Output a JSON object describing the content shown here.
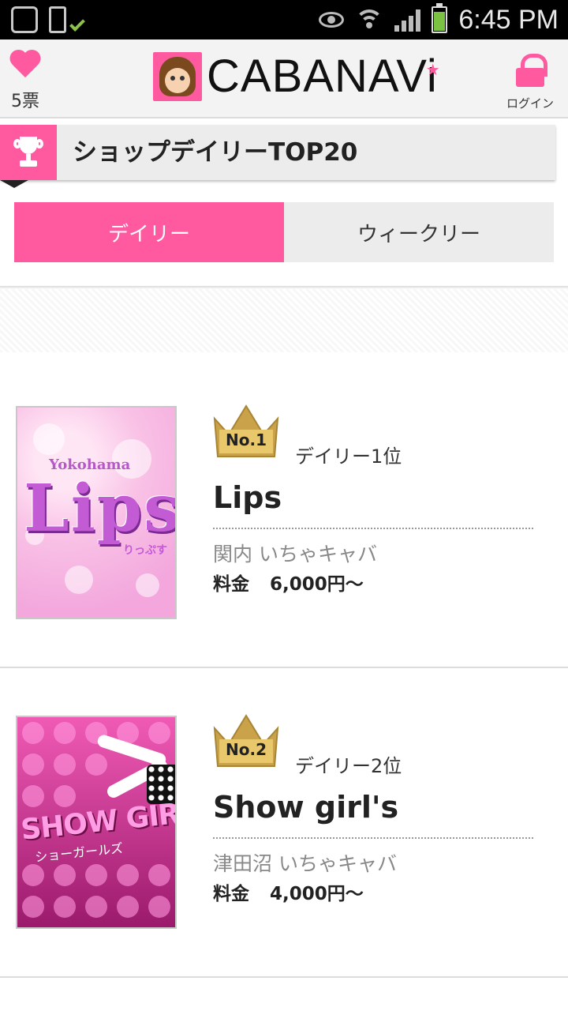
{
  "status_bar": {
    "time": "6:45 PM"
  },
  "header": {
    "vote_count": "5票",
    "logo_text": "CABANAVi",
    "login_label": "ログイン"
  },
  "section": {
    "title": "ショップデイリーTOP20"
  },
  "tabs": [
    {
      "label": "デイリー",
      "active": true
    },
    {
      "label": "ウィークリー",
      "active": false
    }
  ],
  "ranking": [
    {
      "badge": "No.1",
      "rank_label": "デイリー1位",
      "name": "Lips",
      "area": "関内 いちゃキャバ",
      "price_label": "料金",
      "price": "6,000円〜",
      "image": {
        "top": "Yokohama",
        "word": "Lips",
        "kana": "りっぷす"
      }
    },
    {
      "badge": "No.2",
      "rank_label": "デイリー2位",
      "name": "Show girl's",
      "area": "津田沼 いちゃキャバ",
      "price_label": "料金",
      "price": "4,000円〜",
      "image": {
        "word": "SHOW GIRLS",
        "kana": "ショーガールズ"
      }
    }
  ],
  "colors": {
    "accent": "#ff5aa0",
    "gold": "#c9a24a"
  }
}
